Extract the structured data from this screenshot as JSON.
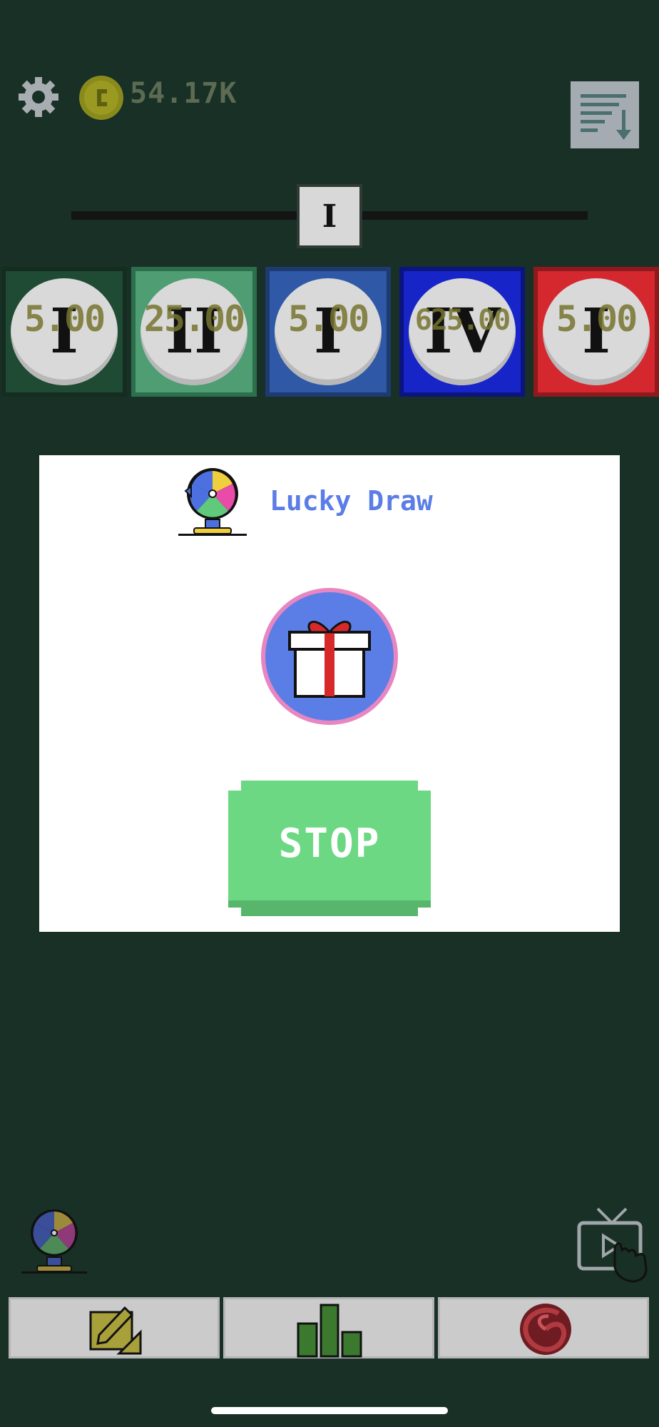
{
  "header": {
    "coin_amount": "54.17K",
    "icons": [
      "gear-icon",
      "coin-icon",
      "sort-list-icon"
    ]
  },
  "level": {
    "current": "I"
  },
  "chips": [
    {
      "numeral": "I",
      "value": "5.00",
      "color": "#2c5a3e"
    },
    {
      "numeral": "II",
      "value": "25.00",
      "color": "#4e9d73"
    },
    {
      "numeral": "I",
      "value": "5.00",
      "color": "#2f58a6"
    },
    {
      "numeral": "IV",
      "value": "625.00",
      "color": "#1724c8"
    },
    {
      "numeral": "I",
      "value": "5.00",
      "color": "#d4282e"
    }
  ],
  "modal": {
    "title": "Lucky Draw",
    "stop_label": "STOP",
    "accent_color": "#5b7de6",
    "stop_color": "#6cd884"
  },
  "bottom_tabs": [
    {
      "icon": "blueprint-icon"
    },
    {
      "icon": "bar-chart-icon"
    },
    {
      "icon": "spiral-icon"
    }
  ],
  "side_buttons": [
    "lucky-wheel-icon",
    "watch-ad-tv-icon"
  ]
}
